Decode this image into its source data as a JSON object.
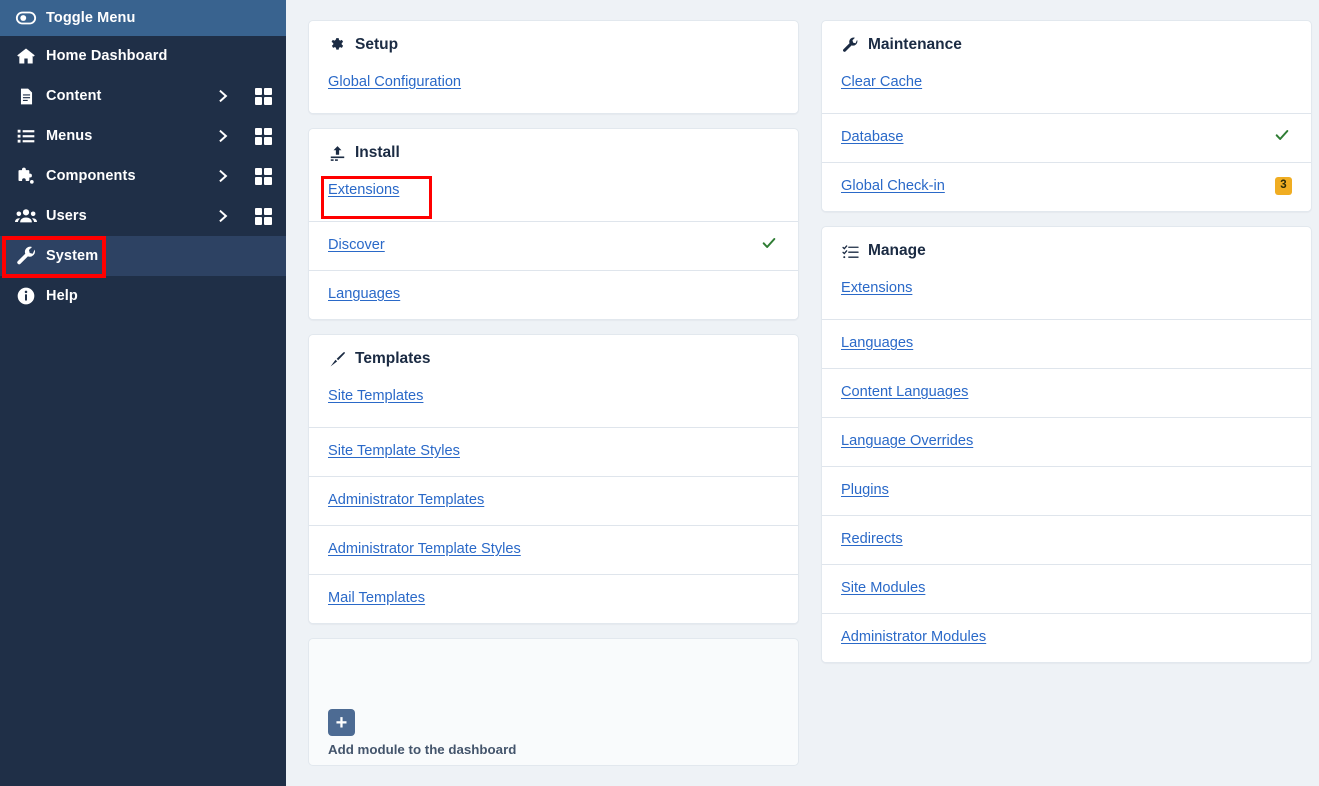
{
  "sidebar": {
    "toggle": {
      "label": "Toggle Menu",
      "icon": "toggle-icon"
    },
    "items": [
      {
        "label": "Home Dashboard",
        "icon": "home-icon",
        "has_chevron": false,
        "has_grid": false,
        "active": false
      },
      {
        "label": "Content",
        "icon": "document-icon",
        "has_chevron": true,
        "has_grid": true,
        "active": false
      },
      {
        "label": "Menus",
        "icon": "list-icon",
        "has_chevron": true,
        "has_grid": true,
        "active": false
      },
      {
        "label": "Components",
        "icon": "puzzle-icon",
        "has_chevron": true,
        "has_grid": true,
        "active": false
      },
      {
        "label": "Users",
        "icon": "users-icon",
        "has_chevron": true,
        "has_grid": true,
        "active": false
      },
      {
        "label": "System",
        "icon": "wrench-icon",
        "has_chevron": false,
        "has_grid": false,
        "active": true
      },
      {
        "label": "Help",
        "icon": "info-icon",
        "has_chevron": false,
        "has_grid": false,
        "active": false
      }
    ]
  },
  "panels": {
    "setup": {
      "title": "Setup",
      "icon": "gear-icon",
      "rows": [
        {
          "label": "Global Configuration",
          "trail": "none"
        }
      ]
    },
    "install": {
      "title": "Install",
      "icon": "upload-icon",
      "rows": [
        {
          "label": "Extensions",
          "trail": "none",
          "highlighted": true
        },
        {
          "label": "Discover",
          "trail": "check"
        },
        {
          "label": "Languages",
          "trail": "none"
        }
      ]
    },
    "templates": {
      "title": "Templates",
      "icon": "paintbrush-icon",
      "rows": [
        {
          "label": "Site Templates",
          "trail": "none"
        },
        {
          "label": "Site Template Styles",
          "trail": "none"
        },
        {
          "label": "Administrator Templates",
          "trail": "none"
        },
        {
          "label": "Administrator Template Styles",
          "trail": "none"
        },
        {
          "label": "Mail Templates",
          "trail": "none"
        }
      ]
    },
    "maintenance": {
      "title": "Maintenance",
      "icon": "wrench-icon",
      "rows": [
        {
          "label": "Clear Cache",
          "trail": "none"
        },
        {
          "label": "Database",
          "trail": "check"
        },
        {
          "label": "Global Check-in",
          "trail": "badge",
          "badge": "3"
        }
      ]
    },
    "manage": {
      "title": "Manage",
      "icon": "checklist-icon",
      "rows": [
        {
          "label": "Extensions",
          "trail": "none"
        },
        {
          "label": "Languages",
          "trail": "none"
        },
        {
          "label": "Content Languages",
          "trail": "none"
        },
        {
          "label": "Language Overrides",
          "trail": "none"
        },
        {
          "label": "Plugins",
          "trail": "none"
        },
        {
          "label": "Redirects",
          "trail": "none"
        },
        {
          "label": "Site Modules",
          "trail": "none"
        },
        {
          "label": "Administrator Modules",
          "trail": "none"
        }
      ]
    },
    "add_module": {
      "label": "Add module to the dashboard",
      "icon": "plus-square-icon",
      "plus": "+"
    }
  },
  "colors": {
    "sidebar_bg": "#1f2f47",
    "sidebar_active": "#2d4263",
    "toggle_bg": "#39638f",
    "link": "#2a69c8",
    "check_green": "#2f7d34",
    "badge_amber": "#f0ad22",
    "annotation_red": "#ff0000",
    "page_bg": "#eef2f6"
  }
}
